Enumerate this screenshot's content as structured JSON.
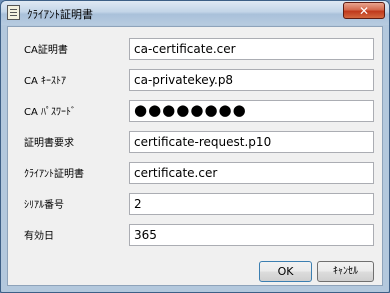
{
  "window": {
    "title": "ｸﾗｲｱﾝﾄ証明書",
    "close_label": "✕"
  },
  "fields": [
    {
      "label": "CA証明書",
      "value": "ca-certificate.cer"
    },
    {
      "label": "CA ｷｰｽﾄｱ",
      "value": "ca-privatekey.p8"
    },
    {
      "label": "CA ﾊﾟｽﾜｰﾄﾞ",
      "value": "●●●●●●●●"
    },
    {
      "label": "証明書要求",
      "value": "certificate-request.p10"
    },
    {
      "label": "ｸﾗｲｱﾝﾄ証明書",
      "value": "certificate.cer"
    },
    {
      "label": "ｼﾘｱﾙ番号",
      "value": "2"
    },
    {
      "label": "有効日",
      "value": "365"
    }
  ],
  "buttons": {
    "ok": "OK",
    "cancel": "ｷｬﾝｾﾙ"
  },
  "colors": {
    "title_bar": "#c3d5e8",
    "close": "#c0391c",
    "dialog_bg": "#f0f0f0"
  }
}
